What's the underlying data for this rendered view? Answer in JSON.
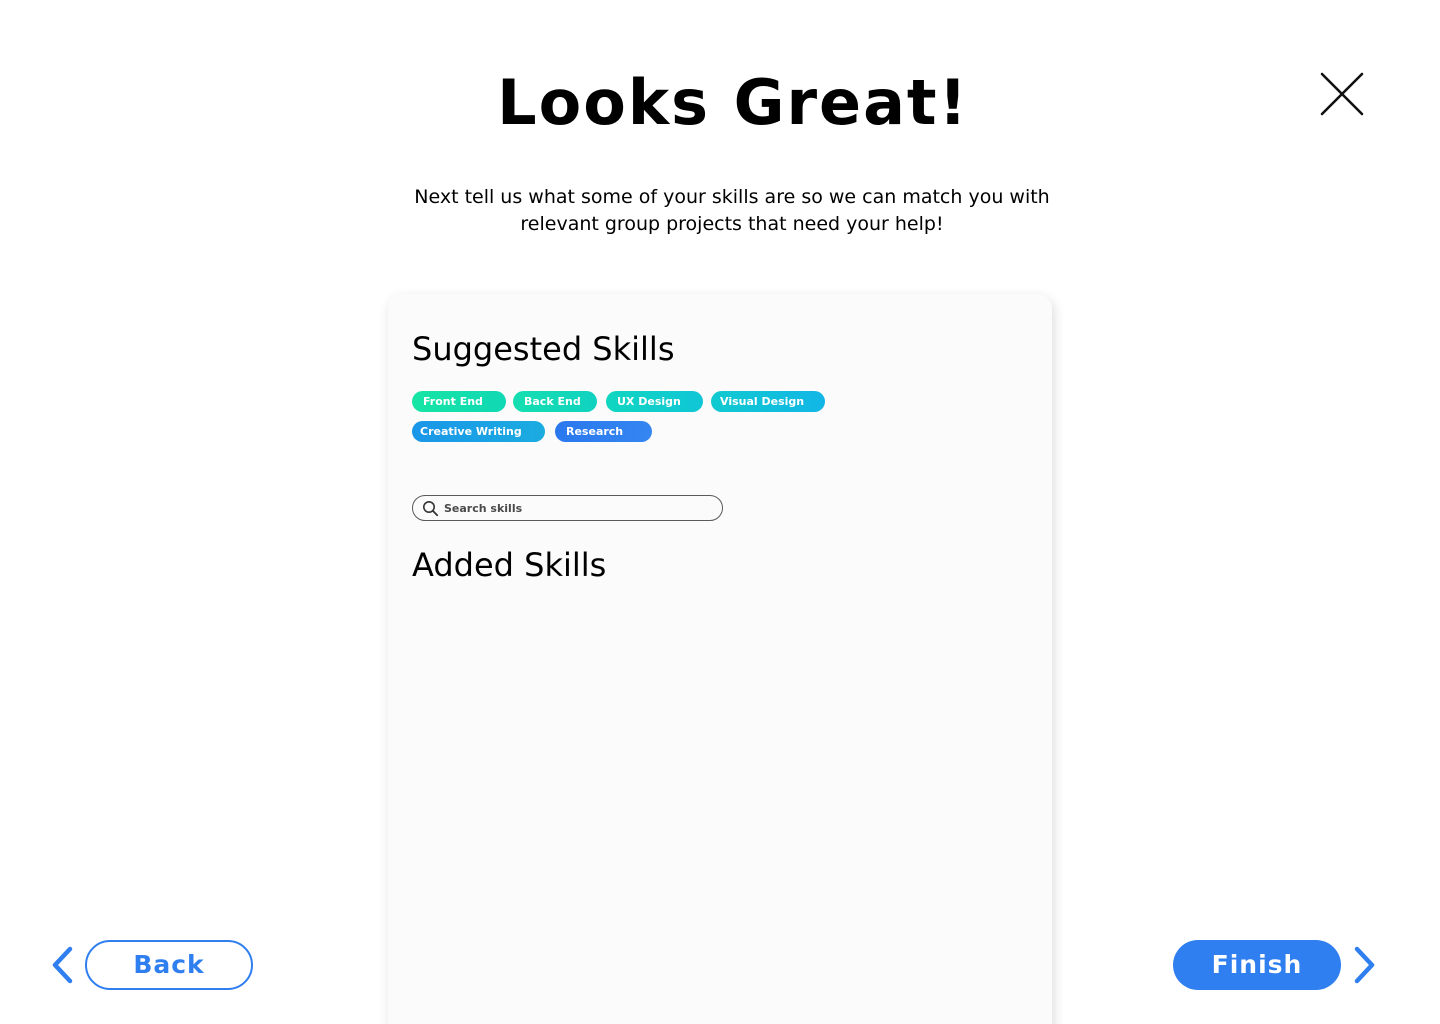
{
  "header": {
    "title": "Looks Great!",
    "subtitle": "Next tell us what some of your skills are so we can match you with relevant group projects that need your help!",
    "close_icon": "close-icon"
  },
  "card": {
    "suggested_title": "Suggested Skills",
    "suggested_skills": [
      {
        "label": "Front End",
        "color_from": "#16e5a4",
        "color_to": "#10d8b4"
      },
      {
        "label": "Back End",
        "color_from": "#14dfb0",
        "color_to": "#10d2c0"
      },
      {
        "label": "UX Design",
        "color_from": "#10d6c0",
        "color_to": "#0fc6d6"
      },
      {
        "label": "Visual Design",
        "color_from": "#0fcad0",
        "color_to": "#12b6e6"
      },
      {
        "label": "Creative Writing",
        "color_from": "#1a96e8",
        "color_to": "#1bace0"
      },
      {
        "label": "Research",
        "color_from": "#2a78ee",
        "color_to": "#3486f2"
      }
    ],
    "search": {
      "placeholder": "Search skills",
      "icon": "search-icon"
    },
    "added_title": "Added Skills",
    "added_skills": []
  },
  "footer": {
    "back_label": "Back",
    "finish_label": "Finish",
    "back_icon": "chevron-left-icon",
    "next_icon": "chevron-right-icon"
  },
  "colors": {
    "accent": "#2f7ff0",
    "card_background": "#fbfbfb"
  }
}
